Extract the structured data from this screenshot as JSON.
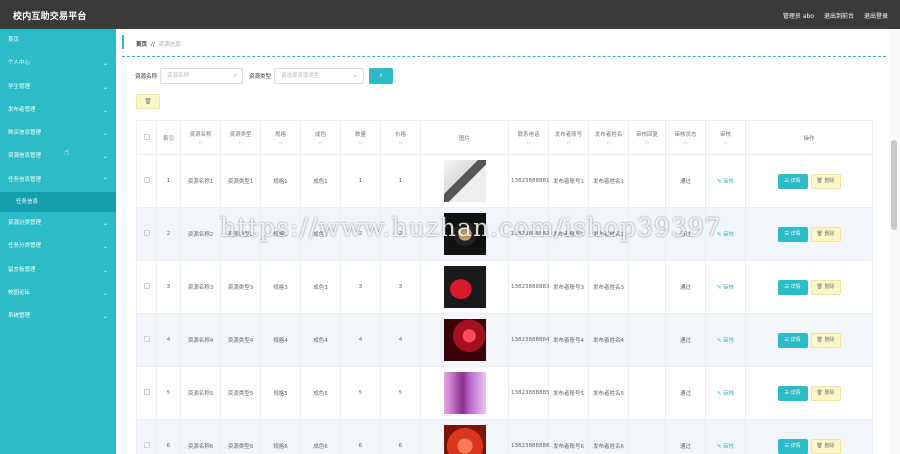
{
  "header": {
    "title": "校内互助交易平台",
    "admin": "管理员 abo",
    "exit_front": "退出到前台",
    "logout": "退出登录"
  },
  "sidebar": {
    "items": [
      {
        "label": "首页",
        "chevron": false
      },
      {
        "label": "个人中心",
        "chevron": true
      },
      {
        "label": "学生管理",
        "chevron": true
      },
      {
        "label": "发布者管理",
        "chevron": true
      },
      {
        "label": "购买信息管理",
        "chevron": true
      },
      {
        "label": "资源信息管理",
        "chevron": true
      },
      {
        "label": "任务信息管理",
        "chevron": true,
        "expanded": true
      }
    ],
    "sub_item": "任务信息",
    "items_after": [
      {
        "label": "资源分类管理",
        "chevron": true
      },
      {
        "label": "任务分类管理",
        "chevron": true
      },
      {
        "label": "留言板管理",
        "chevron": true
      },
      {
        "label": "校园论坛",
        "chevron": true
      },
      {
        "label": "系统管理",
        "chevron": true
      }
    ]
  },
  "breadcrumb": {
    "home": "首页",
    "sep": "//",
    "current": "资源信息"
  },
  "search": {
    "name_label": "资源名称",
    "name_placeholder": "资源名称",
    "type_label": "资源类型",
    "type_placeholder": "请选择资源类型",
    "search_icon": "search-icon",
    "dropdown_icon": "chevron-down-icon"
  },
  "toolbar": {
    "delete_icon": "trash-icon"
  },
  "table": {
    "headers": [
      "",
      "索引",
      "资源名称",
      "资源类型",
      "规格",
      "成色",
      "数量",
      "价格",
      "图片",
      "联系电话",
      "发布者账号",
      "发布者姓名",
      "审核回复",
      "审核状态",
      "审核",
      "操作"
    ],
    "sort_glyph": "◇",
    "audit_label": "审核",
    "detail_label": "详情",
    "delete_label": "删除",
    "rows": [
      {
        "idx": "1",
        "name": "资源名称1",
        "type": "资源类型1",
        "spec": "规格1",
        "cond": "成色1",
        "qty": "1",
        "price": "1",
        "pic": "book",
        "phone": "13823888881",
        "acct": "发布者账号1",
        "pname": "发布者姓名1",
        "reply": "",
        "status": "通过"
      },
      {
        "idx": "2",
        "name": "资源名称2",
        "type": "资源类型2",
        "spec": "规格2",
        "cond": "成色2",
        "qty": "2",
        "price": "2",
        "pic": "watch",
        "phone": "13823888882",
        "acct": "发布者账号2",
        "pname": "发布者姓名2",
        "reply": "",
        "status": "通过"
      },
      {
        "idx": "3",
        "name": "资源名称3",
        "type": "资源类型3",
        "spec": "规格3",
        "cond": "成色3",
        "qty": "3",
        "price": "3",
        "pic": "shoes",
        "phone": "13823888883",
        "acct": "发布者账号3",
        "pname": "发布者姓名3",
        "reply": "",
        "status": "通过"
      },
      {
        "idx": "4",
        "name": "资源名称4",
        "type": "资源类型4",
        "spec": "规格4",
        "cond": "成色4",
        "qty": "4",
        "price": "4",
        "pic": "cosmetics",
        "phone": "13823888884",
        "acct": "发布者账号4",
        "pname": "发布者姓名4",
        "reply": "",
        "status": "通过"
      },
      {
        "idx": "5",
        "name": "资源名称5",
        "type": "资源类型5",
        "spec": "规格5",
        "cond": "成色5",
        "qty": "5",
        "price": "5",
        "pic": "bottle",
        "phone": "13823888885",
        "acct": "发布者账号5",
        "pname": "发布者姓名5",
        "reply": "",
        "status": "通过"
      },
      {
        "idx": "6",
        "name": "资源名称6",
        "type": "资源类型6",
        "spec": "规格6",
        "cond": "成色6",
        "qty": "6",
        "price": "6",
        "pic": "flowers",
        "phone": "13823888886",
        "acct": "发布者账号6",
        "pname": "发布者姓名6",
        "reply": "",
        "status": "通过"
      }
    ]
  },
  "watermark": "https://www.huzhan.com/ishop39397",
  "colors": {
    "accent": "#2bbcc7",
    "header": "#3a3a3a",
    "warn_bg": "#fbf7c6"
  }
}
